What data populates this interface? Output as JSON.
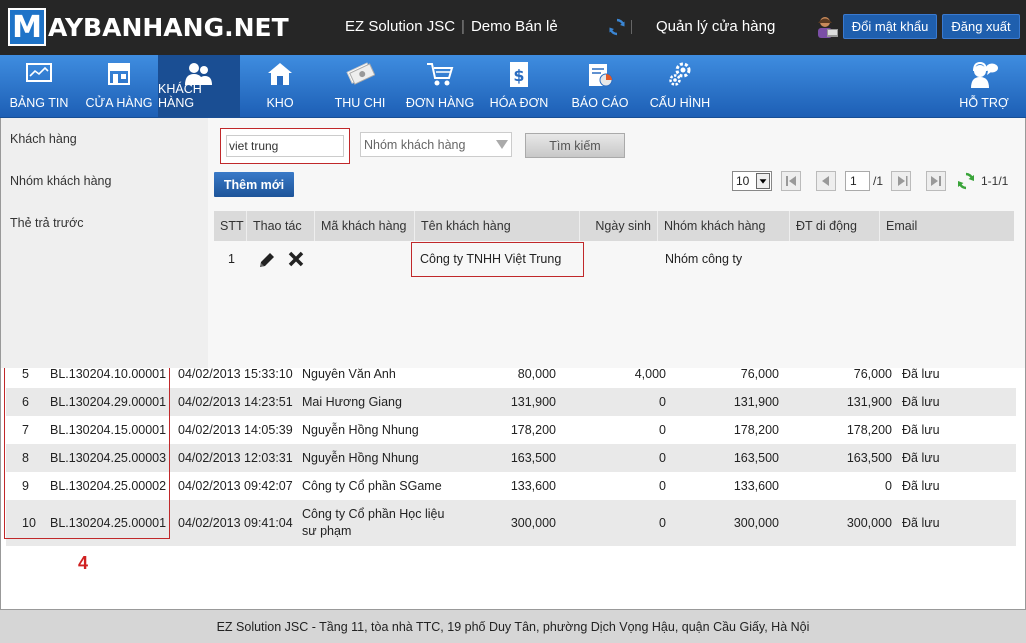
{
  "header": {
    "logo_letter": "M",
    "logo_text": "AYBANHANG.NET",
    "company": "EZ Solution JSC",
    "store": "Demo Bán lẻ",
    "store_manager": "Quản lý cửa hàng",
    "change_password": "Đổi mật khẩu",
    "logout": "Đăng xuất"
  },
  "nav": [
    {
      "label": "BẢNG TIN",
      "icon": "dashboard-icon"
    },
    {
      "label": "CỬA HÀNG",
      "icon": "store-icon"
    },
    {
      "label": "KHÁCH HÀNG",
      "icon": "customers-icon"
    },
    {
      "label": "KHO",
      "icon": "warehouse-icon"
    },
    {
      "label": "THU CHI",
      "icon": "money-icon"
    },
    {
      "label": "ĐƠN HÀNG",
      "icon": "cart-icon"
    },
    {
      "label": "HÓA ĐƠN",
      "icon": "invoice-icon"
    },
    {
      "label": "BÁO CÁO",
      "icon": "report-icon"
    },
    {
      "label": "CẤU HÌNH",
      "icon": "settings-icon"
    },
    {
      "label": "HỖ TRỢ",
      "icon": "support-icon"
    }
  ],
  "sidebar": {
    "items": [
      {
        "label": "Khách hàng"
      },
      {
        "label": "Nhóm khách hàng"
      },
      {
        "label": "Thẻ trả trước"
      }
    ]
  },
  "filter": {
    "search_value": "viet trung",
    "group_placeholder": "Nhóm khách hàng",
    "search_button": "Tìm kiếm",
    "add_button": "Thêm mới"
  },
  "pager": {
    "page_size": "10",
    "page": "1",
    "total": "/1",
    "range": "1-1/1"
  },
  "grid": {
    "columns": [
      "STT",
      "Thao tác",
      "Mã khách hàng",
      "Tên khách hàng",
      "Ngày sinh",
      "Nhóm khách hàng",
      "ĐT di động",
      "Email"
    ],
    "rows": [
      {
        "stt": "1",
        "code": "",
        "name": "Công ty TNHH Việt Trung",
        "birthday": "",
        "group": "Nhóm công ty",
        "phone": "",
        "email": ""
      }
    ]
  },
  "background_table": {
    "rows": [
      {
        "stt": "5",
        "code": "BL.130204.10.00001",
        "date": "04/02/2013 15:33:10",
        "customer": "Nguyễn Văn Anh",
        "c1": "80,000",
        "c2": "4,000",
        "c3": "76,000",
        "c4": "76,000",
        "status": "Đã lưu"
      },
      {
        "stt": "6",
        "code": "BL.130204.29.00001",
        "date": "04/02/2013 14:23:51",
        "customer": "Mai Hương Giang",
        "c1": "131,900",
        "c2": "0",
        "c3": "131,900",
        "c4": "131,900",
        "status": "Đã lưu"
      },
      {
        "stt": "7",
        "code": "BL.130204.15.00001",
        "date": "04/02/2013 14:05:39",
        "customer": "Nguyễn Hồng Nhung",
        "c1": "178,200",
        "c2": "0",
        "c3": "178,200",
        "c4": "178,200",
        "status": "Đã lưu"
      },
      {
        "stt": "8",
        "code": "BL.130204.25.00003",
        "date": "04/02/2013 12:03:31",
        "customer": "Nguyễn Hồng Nhung",
        "c1": "163,500",
        "c2": "0",
        "c3": "163,500",
        "c4": "163,500",
        "status": "Đã lưu"
      },
      {
        "stt": "9",
        "code": "BL.130204.25.00002",
        "date": "04/02/2013 09:42:07",
        "customer": "Công ty Cổ phần SGame",
        "c1": "133,600",
        "c2": "0",
        "c3": "133,600",
        "c4": "0",
        "status": "Đã lưu"
      },
      {
        "stt": "10",
        "code": "BL.130204.25.00001",
        "date": "04/02/2013 09:41:04",
        "customer": "Công ty Cổ phần Học liệu sư phạm",
        "c1": "300,000",
        "c2": "0",
        "c3": "300,000",
        "c4": "300,000",
        "status": "Đã lưu"
      }
    ],
    "annotation": "4"
  },
  "footer": {
    "text": "EZ Solution JSC - Tầng 11, tòa nhà TTC, 19 phố Duy Tân, phường Dịch Vọng Hậu, quận Cầu Giấy, Hà Nội"
  },
  "colors": {
    "accent": "#1f5fae",
    "highlight": "#c0282a"
  }
}
